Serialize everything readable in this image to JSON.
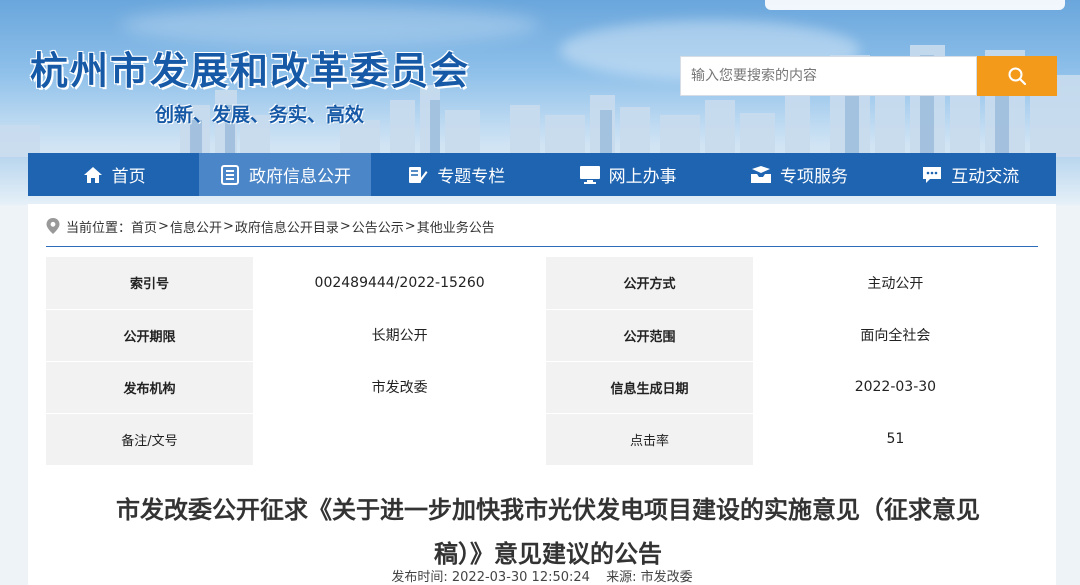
{
  "header": {
    "title": "杭州市发展和改革委员会",
    "slogan": "创新、发展、务实、高效",
    "search": {
      "placeholder": "输入您要搜索的内容",
      "button_icon": "search-icon"
    }
  },
  "nav": {
    "items": [
      {
        "label": "首页",
        "icon": "home-icon",
        "active": false
      },
      {
        "label": "政府信息公开",
        "icon": "document-list-icon",
        "active": true
      },
      {
        "label": "专题专栏",
        "icon": "edit-note-icon",
        "active": false
      },
      {
        "label": "网上办事",
        "icon": "monitor-icon",
        "active": false
      },
      {
        "label": "专项服务",
        "icon": "mail-tray-icon",
        "active": false
      },
      {
        "label": "互动交流",
        "icon": "chat-bubble-icon",
        "active": false
      }
    ]
  },
  "breadcrumb": {
    "prefix": "当前位置：",
    "items": [
      "首页",
      "信息公开",
      "政府信息公开目录",
      "公告公示",
      "其他业务公告"
    ],
    "separator": ">"
  },
  "meta_table": {
    "rows": [
      {
        "l1": "索引号",
        "v1": "002489444/2022-15260",
        "l2": "公开方式",
        "v2": "主动公开"
      },
      {
        "l1": "公开期限",
        "v1": "长期公开",
        "l2": "公开范围",
        "v2": "面向全社会"
      },
      {
        "l1": "发布机构",
        "v1": "市发改委",
        "l2": "信息生成日期",
        "v2": "2022-03-30"
      },
      {
        "l1": "备注/文号",
        "v1": "",
        "l2": "点击率",
        "v2": "51"
      }
    ]
  },
  "article": {
    "title_line1": "市发改委公开征求《关于进一步加快我市光伏发电项目建设的实施意见（征求意见",
    "title_line2": "稿）》意见建议的公告",
    "publish_time_label": "发布时间:",
    "publish_time": "2022-03-30 12:50:24",
    "source_label": "来源:",
    "source": "市发改委"
  },
  "colors": {
    "brand_blue": "#1f64b1",
    "nav_active": "#4b86c8",
    "search_orange": "#f39a1a",
    "title_blue": "#1659a6"
  }
}
